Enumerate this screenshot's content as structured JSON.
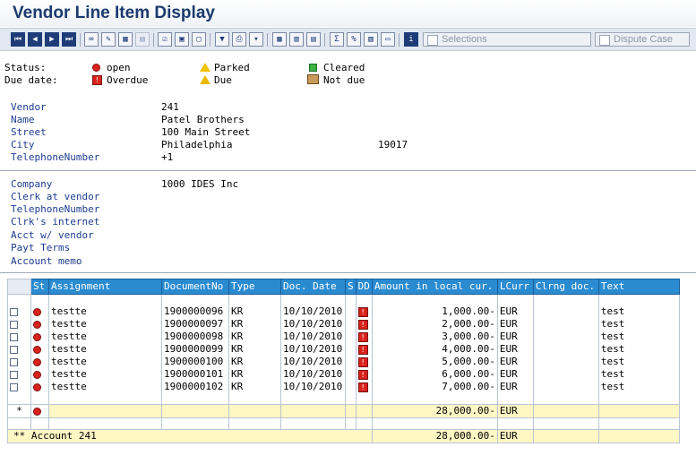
{
  "title": "Vendor Line Item Display",
  "toolbar": {
    "selections_label": "Selections",
    "dispute_label": "Dispute Case"
  },
  "legend": {
    "status_label": "Status:",
    "due_label": "Due date:",
    "open": "open",
    "parked": "Parked",
    "cleared": "Cleared",
    "overdue": "Overdue",
    "due": "Due",
    "not_due": "Not due"
  },
  "vendor": {
    "vendor_label": "Vendor",
    "vendor_value": "241",
    "name_label": "Name",
    "name_value": "Patel Brothers",
    "street_label": "Street",
    "street_value": "100 Main Street",
    "city_label": "City",
    "city_value": "Philadelphia",
    "postal_value": "19017",
    "phone_label": "TelephoneNumber",
    "phone_value": "+1"
  },
  "company": {
    "company_label": "Company",
    "company_value": "1000 IDES Inc",
    "clerk_label": "Clerk at vendor",
    "phone_label": "TelephoneNumber",
    "internet_label": "Clrk's internet",
    "acct_label": "Acct w/ vendor",
    "terms_label": "Payt Terms",
    "memo_label": "Account memo"
  },
  "table": {
    "headers": [
      "St",
      "Assignment",
      "DocumentNo",
      "Type",
      "Doc. Date",
      "S",
      "DD",
      "Amount in local cur.",
      "LCurr",
      "Clrng doc.",
      "Text"
    ],
    "rows": [
      {
        "assignment": "testte",
        "docno": "1900000096",
        "type": "KR",
        "date": "10/10/2010",
        "amount": "1,000.00-",
        "curr": "EUR",
        "text": "test"
      },
      {
        "assignment": "testte",
        "docno": "1900000097",
        "type": "KR",
        "date": "10/10/2010",
        "amount": "2,000.00-",
        "curr": "EUR",
        "text": "test"
      },
      {
        "assignment": "testte",
        "docno": "1900000098",
        "type": "KR",
        "date": "10/10/2010",
        "amount": "3,000.00-",
        "curr": "EUR",
        "text": "test"
      },
      {
        "assignment": "testte",
        "docno": "1900000099",
        "type": "KR",
        "date": "10/10/2010",
        "amount": "4,000.00-",
        "curr": "EUR",
        "text": "test"
      },
      {
        "assignment": "testte",
        "docno": "1900000100",
        "type": "KR",
        "date": "10/10/2010",
        "amount": "5,000.00-",
        "curr": "EUR",
        "text": "test"
      },
      {
        "assignment": "testte",
        "docno": "1900000101",
        "type": "KR",
        "date": "10/10/2010",
        "amount": "6,000.00-",
        "curr": "EUR",
        "text": "test"
      },
      {
        "assignment": "testte",
        "docno": "1900000102",
        "type": "KR",
        "date": "10/10/2010",
        "amount": "7,000.00-",
        "curr": "EUR",
        "text": "test"
      }
    ],
    "subtotal_marker": "*",
    "subtotal_amount": "28,000.00-",
    "subtotal_curr": "EUR",
    "account_label": "** Account 241",
    "account_amount": "28,000.00-",
    "account_curr": "EUR"
  }
}
